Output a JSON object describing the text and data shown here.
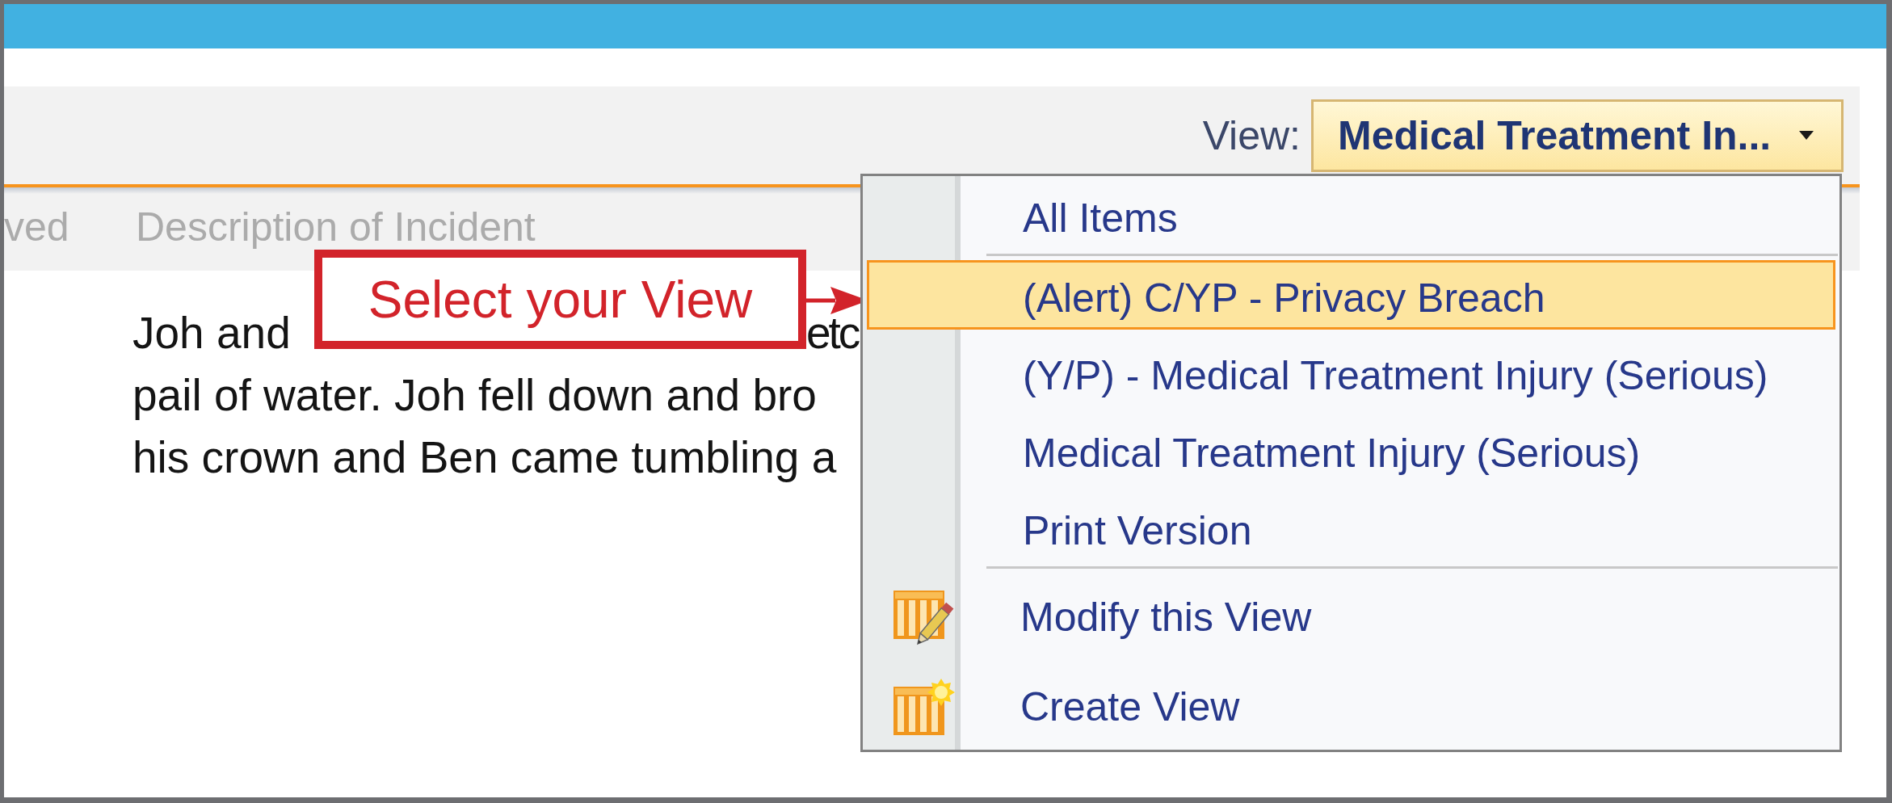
{
  "toolbar": {
    "view_selector": {
      "label": "View:",
      "value": "Medical Treatment In...",
      "expanded": true,
      "menu": {
        "sections": [
          {
            "items": [
              {
                "label": "All Items",
                "kind": "view",
                "selected": false
              }
            ]
          },
          {
            "items": [
              {
                "label": "(Alert) C/YP - Privacy Breach",
                "kind": "view",
                "selected": true
              },
              {
                "label": "(Y/P) - Medical Treatment Injury (Serious)",
                "kind": "view",
                "selected": false
              },
              {
                "label": "Medical Treatment Injury (Serious)",
                "kind": "view",
                "selected": false
              },
              {
                "label": "Print Version",
                "kind": "view",
                "selected": false
              }
            ]
          },
          {
            "items": [
              {
                "label": "Modify this View",
                "kind": "edit",
                "selected": false
              },
              {
                "label": "Create View",
                "kind": "new",
                "selected": false
              }
            ]
          }
        ]
      }
    }
  },
  "list": {
    "columns": [
      {
        "label": "ved"
      },
      {
        "label": "Description of Incident"
      }
    ],
    "description_lines": [
      [
        "Joh and",
        "etc"
      ],
      [
        "pail of water. Joh fell down and bro"
      ],
      [
        "his crown and Ben came tumbling a"
      ]
    ]
  },
  "callout": {
    "text": "Select your View"
  }
}
